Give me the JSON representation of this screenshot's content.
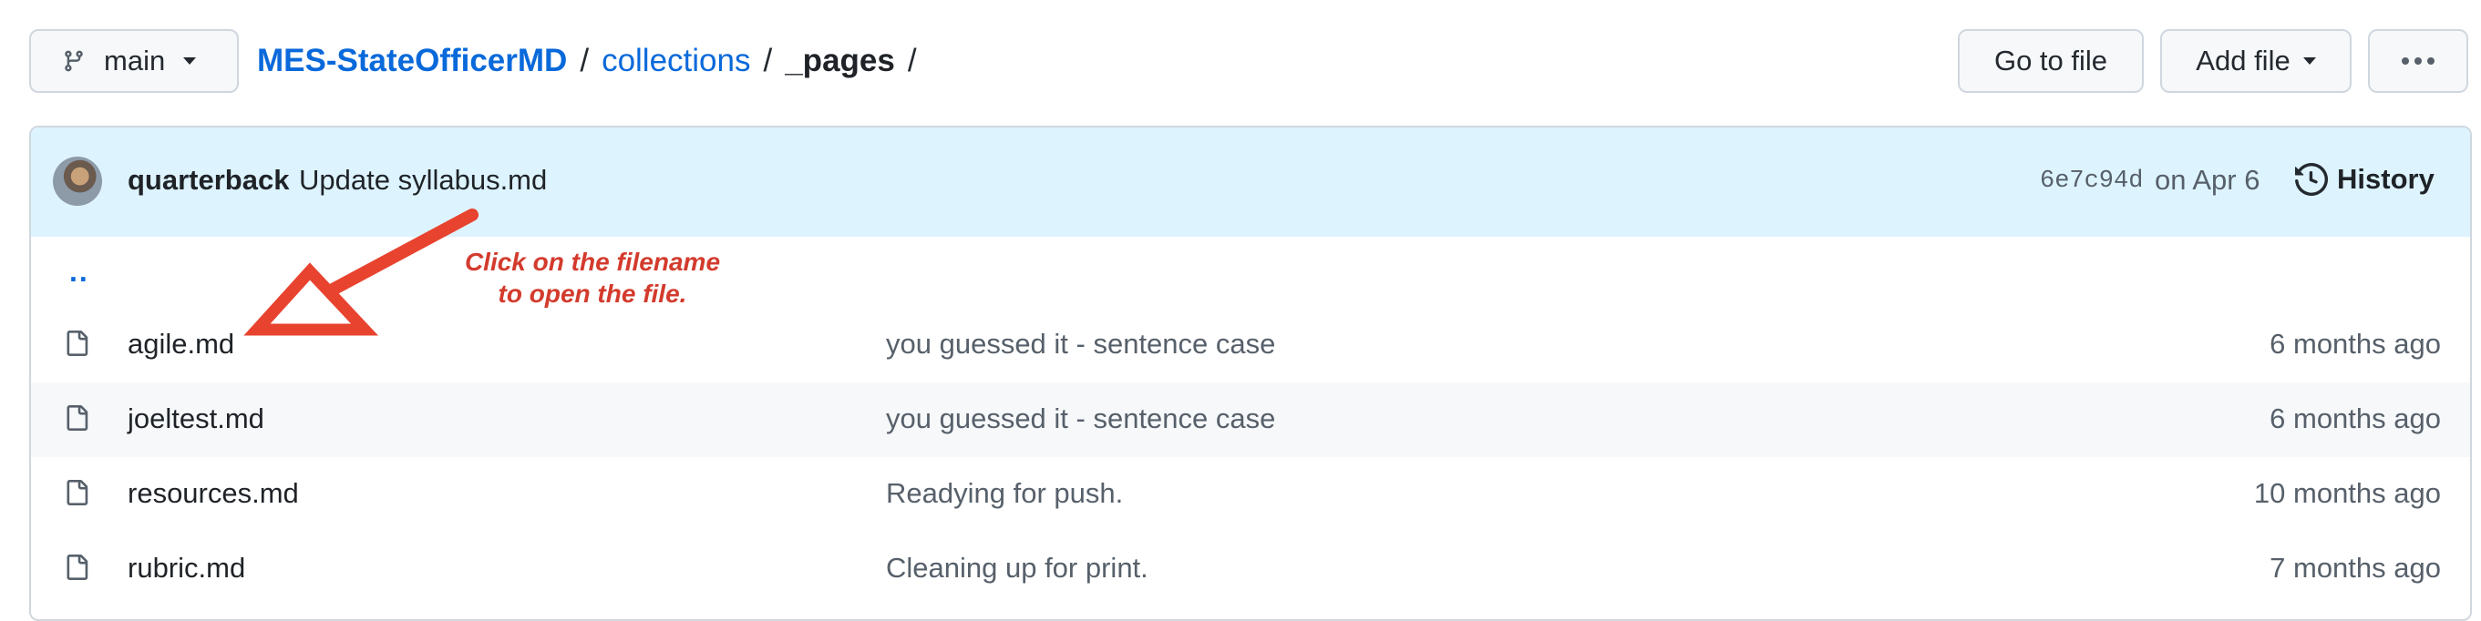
{
  "branch": {
    "label": "main",
    "icon": "git-branch-icon"
  },
  "breadcrumb": {
    "repo": "MES-StateOfficerMD",
    "separator": "/",
    "folder": "collections",
    "current": "_pages",
    "trailing": "/"
  },
  "toolbar": {
    "goto_label": "Go to file",
    "add_label": "Add file",
    "more_label": "···"
  },
  "commit": {
    "author": "quarterback",
    "message": "Update syllabus.md",
    "sha": "6e7c94d",
    "date": "on Apr 6",
    "history_label": "History"
  },
  "parent_link": "..",
  "files": [
    {
      "name": "agile.md",
      "commit": "you guessed it - sentence case",
      "age": "6 months ago"
    },
    {
      "name": "joeltest.md",
      "commit": "you guessed it - sentence case",
      "age": "6 months ago"
    },
    {
      "name": "resources.md",
      "commit": "Readying for push.",
      "age": "10 months ago"
    },
    {
      "name": "rubric.md",
      "commit": "Cleaning up for print.",
      "age": "7 months ago"
    }
  ],
  "annotation": {
    "line1": "Click on the filename",
    "line2": "to open the file.",
    "color": "#d33b2d"
  },
  "colors": {
    "link": "#0969da",
    "commit_bar": "#ddf4ff",
    "border": "#d0d7de"
  }
}
